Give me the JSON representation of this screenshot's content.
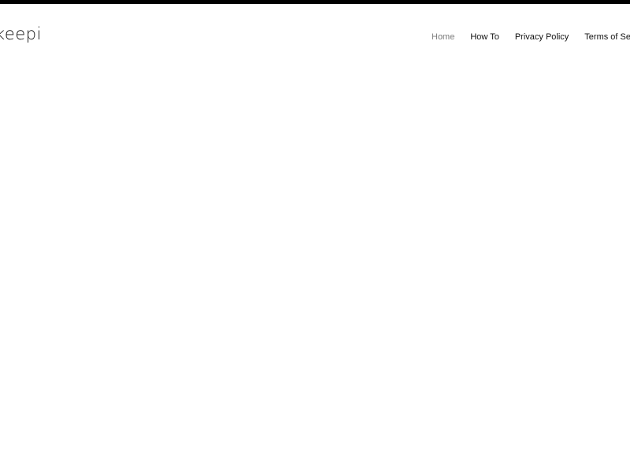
{
  "header": {
    "logo_text": "keepi",
    "nav": [
      {
        "label": "Home",
        "active": true
      },
      {
        "label": "How To",
        "active": false
      },
      {
        "label": "Privacy Policy",
        "active": false
      },
      {
        "label": "Terms of Service",
        "active": false
      }
    ]
  },
  "colors": {
    "top_bar": "#000000",
    "text": "#111111",
    "active_nav": "#7a7a7a",
    "background": "#ffffff"
  }
}
